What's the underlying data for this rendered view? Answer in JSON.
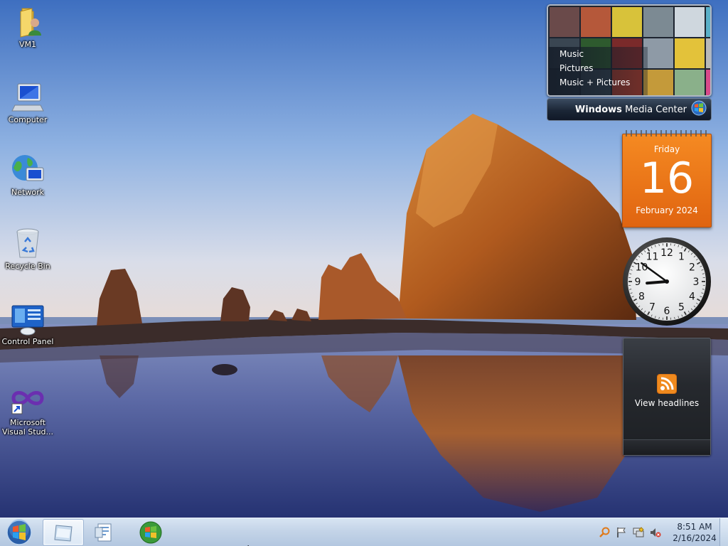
{
  "desktop": {
    "icons": [
      {
        "label": "VM1",
        "icon": "user-folder-icon"
      },
      {
        "label": "Computer",
        "icon": "computer-icon"
      },
      {
        "label": "Network",
        "icon": "network-icon"
      },
      {
        "label": "Recycle Bin",
        "icon": "recycle-bin-icon"
      },
      {
        "label": "Control Panel",
        "icon": "control-panel-icon"
      },
      {
        "label": "Microsoft Visual Stud...",
        "icon": "visual-studio-icon"
      }
    ]
  },
  "media_center": {
    "menu": [
      "Music",
      "Pictures",
      "Music + Pictures"
    ],
    "brand_bold": "Windows",
    "brand_rest": "Media Center"
  },
  "calendar": {
    "weekday": "Friday",
    "day": "16",
    "month_year": "February 2024"
  },
  "analog_clock": {
    "hour": 8,
    "minute": 51,
    "numerals": [
      "12",
      "1",
      "2",
      "3",
      "4",
      "5",
      "6",
      "7",
      "8",
      "9",
      "10",
      "11"
    ]
  },
  "feed": {
    "label": "View headlines"
  },
  "taskbar": {
    "buttons": [
      "explorer-window-icon",
      "document-icon",
      "windows-media-center-icon"
    ],
    "tray": {
      "icons": [
        "search-icon",
        "action-center-flag-icon",
        "network-tray-icon",
        "volume-muted-icon"
      ],
      "time": "8:51 AM",
      "date": "2/16/2024"
    }
  },
  "colors": {
    "calendar_orange": "#f07a1a",
    "taskbar_top": "#d7e4f2",
    "gadget_dark": "#26292e"
  }
}
